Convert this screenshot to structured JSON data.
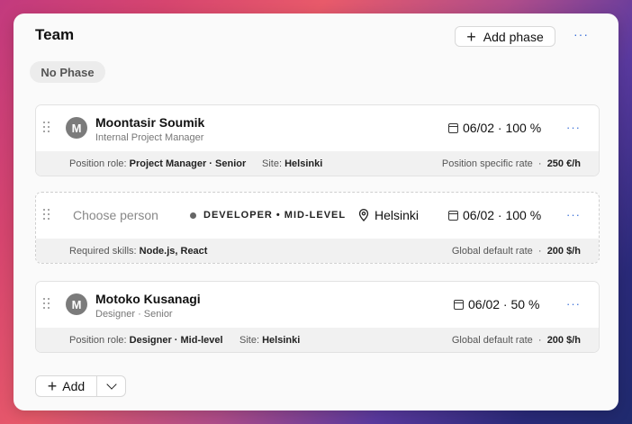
{
  "header": {
    "title": "Team",
    "add_phase_label": "Add phase",
    "more_label": "···"
  },
  "phase": {
    "label": "No Phase"
  },
  "rows": [
    {
      "avatar_initial": "M",
      "name": "Moontasir Soumik",
      "subtitle": "Internal Project Manager",
      "date_allocation": "06/02 · 100 %",
      "more_label": "···",
      "footer": {
        "role_label": "Position role:",
        "role_value": "Project Manager · Senior",
        "site_label": "Site:",
        "site_value": "Helsinki",
        "rate_label": "Position specific rate",
        "rate_sep": "·",
        "rate_value": "250 €/h"
      }
    },
    {
      "placeholder": "Choose person",
      "role_tag": "DEVELOPER • MID-LEVEL",
      "location": "Helsinki",
      "date_allocation": "06/02 · 100 %",
      "more_label": "···",
      "footer": {
        "skills_label": "Required skills:",
        "skills_value": "Node.js, React",
        "rate_label": "Global default rate",
        "rate_sep": "·",
        "rate_value": "200 $/h"
      }
    },
    {
      "avatar_initial": "M",
      "name": "Motoko Kusanagi",
      "subtitle": "Designer · Senior",
      "date_allocation": "06/02 · 50 %",
      "more_label": "···",
      "footer": {
        "role_label": "Position role:",
        "role_value": "Designer · Mid-level",
        "site_label": "Site:",
        "site_value": "Helsinki",
        "rate_label": "Global default rate",
        "rate_sep": "·",
        "rate_value": "200 $/h"
      }
    }
  ],
  "footer_actions": {
    "add_label": "Add"
  },
  "icons": {
    "plus": "plus-icon",
    "more": "more-horizontal-icon",
    "drag": "drag-handle-icon",
    "calendar": "calendar-icon",
    "location": "map-pin-icon",
    "chevron": "chevron-down-icon"
  },
  "colors": {
    "accent": "#3a6fd8",
    "avatar": "#7b7b7b"
  }
}
